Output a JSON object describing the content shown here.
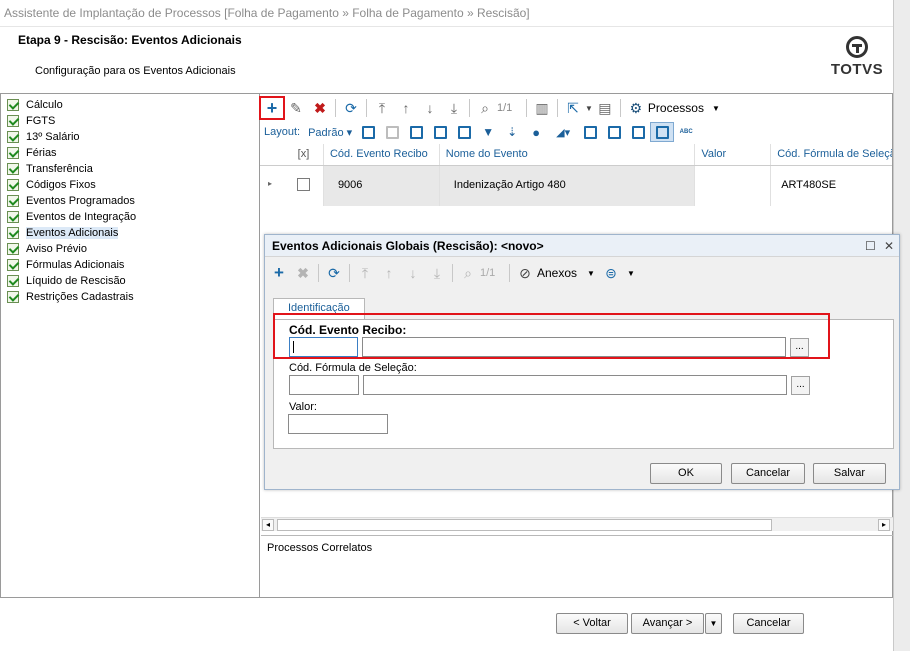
{
  "window": {
    "title": "Assistente de Implantação de Processos [Folha de Pagamento » Folha de Pagamento » Rescisão]"
  },
  "header": {
    "step_title": "Etapa 9 - Rescisão: Eventos Adicionais",
    "step_subtitle": "Configuração para os Eventos Adicionais",
    "logo_text": "TOTVS"
  },
  "sidebar": {
    "items": [
      {
        "label": "Cálculo"
      },
      {
        "label": "FGTS"
      },
      {
        "label": "13º Salário"
      },
      {
        "label": "Férias"
      },
      {
        "label": "Transferência"
      },
      {
        "label": "Códigos Fixos"
      },
      {
        "label": "Eventos Programados"
      },
      {
        "label": "Eventos de Integração"
      },
      {
        "label": "Eventos Adicionais"
      },
      {
        "label": "Aviso Prévio"
      },
      {
        "label": "Fórmulas Adicionais"
      },
      {
        "label": "Líquido de Rescisão"
      },
      {
        "label": "Restrições Cadastrais"
      }
    ]
  },
  "toolbar": {
    "page_counter": "1/1",
    "processos_label": "Processos"
  },
  "layout_bar": {
    "layout_label": "Layout:",
    "layout_value": "Padrão ▾",
    "abc_label": "ABC"
  },
  "grid": {
    "columns": [
      "[x]",
      "Cód. Evento Recibo",
      "Nome do Evento",
      "Valor",
      "Cód. Fórmula de Seleção"
    ],
    "rows": [
      {
        "code": "9006",
        "name": "Indenização Artigo 480",
        "value": "",
        "formula": "ART480SE"
      }
    ]
  },
  "dialog": {
    "title": "Eventos Adicionais Globais (Rescisão): <novo>",
    "page_counter": "1/1",
    "anexos_label": "Anexos",
    "tab_label": "Identificação",
    "field_evento_label": "Cód. Evento Recibo:",
    "field_formula_label": "Cód. Fórmula de Seleção:",
    "field_valor_label": "Valor:",
    "dots_label": "...",
    "ok_label": "OK",
    "cancel_label": "Cancelar",
    "save_label": "Salvar"
  },
  "processos_correlatos": {
    "label": "Processos Correlatos"
  },
  "footer": {
    "back_label": "< Voltar",
    "next_label": "Avançar >",
    "cancel_label": "Cancelar"
  },
  "colors": {
    "highlight": "#e1141a",
    "link_blue": "#1b5f99"
  }
}
